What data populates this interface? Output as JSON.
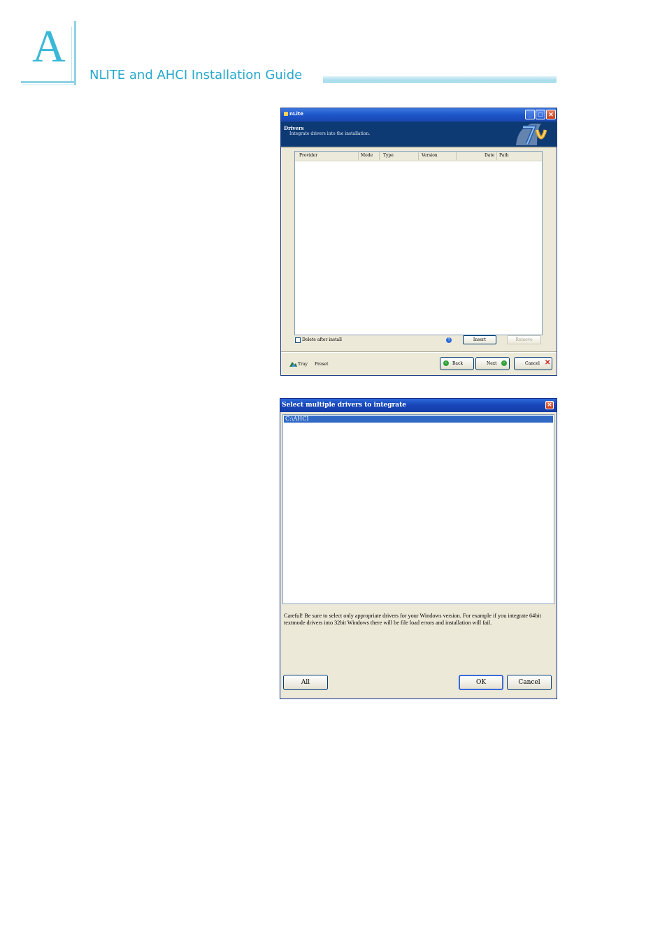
{
  "page_header": {
    "chapter_letter": "A",
    "title": "NLITE and AHCI Installation Guide",
    "accent_color": "#27a8cc"
  },
  "nlite_window": {
    "title": "nLite",
    "caption_buttons": [
      "minimize-icon",
      "maximize-icon",
      "close-icon"
    ],
    "header_title": "Drivers",
    "header_subtitle": "Integrate drivers into the installation.",
    "columns": [
      "Provider",
      "Mode",
      "Type",
      "Version",
      "Date",
      "Path"
    ],
    "delete_after_install_label": "Delete after install",
    "delete_after_install_checked": false,
    "insert_label": "Insert",
    "remove_label": "Remove",
    "tray_label": "Tray",
    "preset_label": "Preset",
    "back_label": "Back",
    "next_label": "Next",
    "cancel_label": "Cancel"
  },
  "select_dialog": {
    "title": "Select multiple drivers to integrate",
    "items": [
      "C:\\AHCI"
    ],
    "selected_index": 0,
    "warning": "Careful! Be sure to select only appropriate drivers for your Windows version. For example if you integrate 64bit textmode drivers into 32bit Windows there will be file load errors and installation will fail.",
    "all_label": "All",
    "ok_label": "OK",
    "cancel_label": "Cancel"
  }
}
